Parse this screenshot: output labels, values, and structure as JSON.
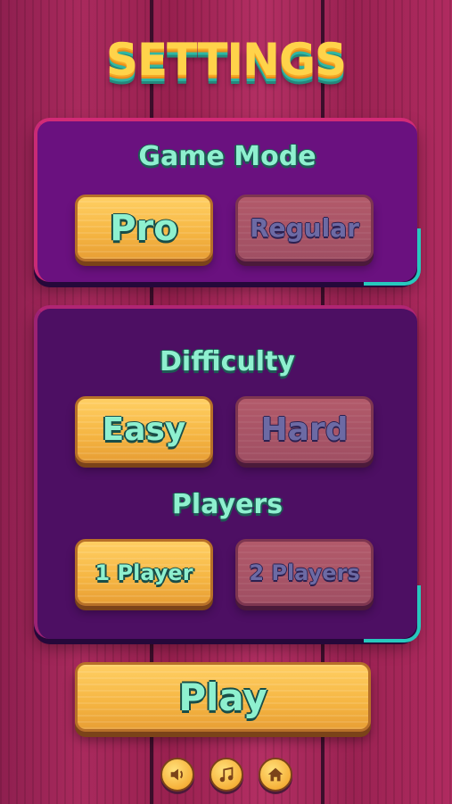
{
  "title": "SETTINGS",
  "game_mode": {
    "heading": "Game Mode",
    "options": [
      "Pro",
      "Regular"
    ],
    "selected": "Pro"
  },
  "difficulty": {
    "heading": "Difficulty",
    "options": [
      "Easy",
      "Hard"
    ],
    "selected": "Easy"
  },
  "players": {
    "heading": "Players",
    "options": [
      "1 Player",
      "2 Players"
    ],
    "selected": "1 Player"
  },
  "play_label": "Play",
  "footer_icons": [
    "sound-icon",
    "music-icon",
    "home-icon"
  ],
  "colors": {
    "accent_text": "#8ef0cf",
    "title": "#ffd34a",
    "button_on": "#f5b542",
    "button_off": "#a04f63",
    "panel_mode": "#6a117f",
    "panel_options": "#4d0f63"
  }
}
